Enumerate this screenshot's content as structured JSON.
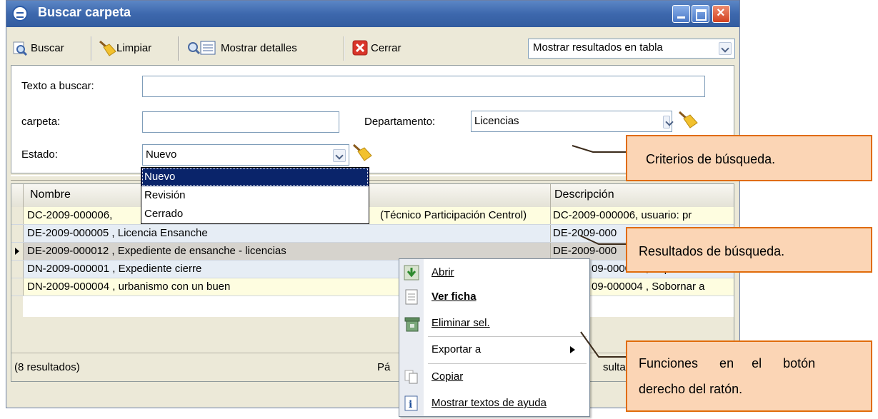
{
  "window": {
    "title": "Buscar carpeta",
    "colors": {
      "titlebar": "#3d68ad",
      "accent": "#e06c0a",
      "callout_fill": "#fbd5b5",
      "selection": "#0a246a"
    }
  },
  "toolbar": {
    "buscar": "Buscar",
    "limpiar": "Limpiar",
    "mostrar_detalles": "Mostrar detalles",
    "cerrar": "Cerrar",
    "view_mode": "Mostrar resultados en tabla"
  },
  "criteria": {
    "texto_label": "Texto a buscar:",
    "texto_value": "",
    "carpeta_label": "carpeta:",
    "carpeta_value": "",
    "departamento_label": "Departamento:",
    "departamento_value": "Licencias",
    "estado_label": "Estado:",
    "estado_value": "Nuevo",
    "estado_options": [
      "Nuevo",
      "Revisión",
      "Cerrado"
    ]
  },
  "results": {
    "columns": [
      "Nombre",
      "Descripción"
    ],
    "rows": [
      {
        "nombre_a": "DC-2009-000006,",
        "nombre_b": "(Técnico Participación Centrol)",
        "descripcion": "DC-2009-000006, usuario: pr"
      },
      {
        "nombre": "DE-2009-000005 , Licencia Ensanche",
        "descripcion": "DE-2009-000"
      },
      {
        "nombre": "DE-2009-000012 , Expediente de ensanche - licencias",
        "descripcion": "DE-2009-000"
      },
      {
        "nombre": "DN-2009-000001 , Expediente cierre",
        "descripcion": "09-000001 , Expedient"
      },
      {
        "nombre": "DN-2009-000004 ,  urbanismo con un buen",
        "descripcion": "09-000004 , Sobornar a"
      }
    ],
    "count_text": "(8 resultados)",
    "pager_text": "Pá",
    "results_tail": "sultad"
  },
  "context_menu": {
    "items": [
      "Abrir",
      "Ver ficha",
      "Eliminar sel.",
      "Exportar a",
      "Copiar",
      "Mostrar textos de ayuda"
    ],
    "icons": [
      "open-icon",
      "document-icon",
      "trash-icon",
      "",
      "copy-icon",
      "help-icon"
    ]
  },
  "callouts": {
    "criterios": "Criterios de búsqueda.",
    "resultados": "Resultados de búsqueda.",
    "funciones_line1": "Funciones      en     el      botón",
    "funciones_line2": "derecho del ratón."
  }
}
